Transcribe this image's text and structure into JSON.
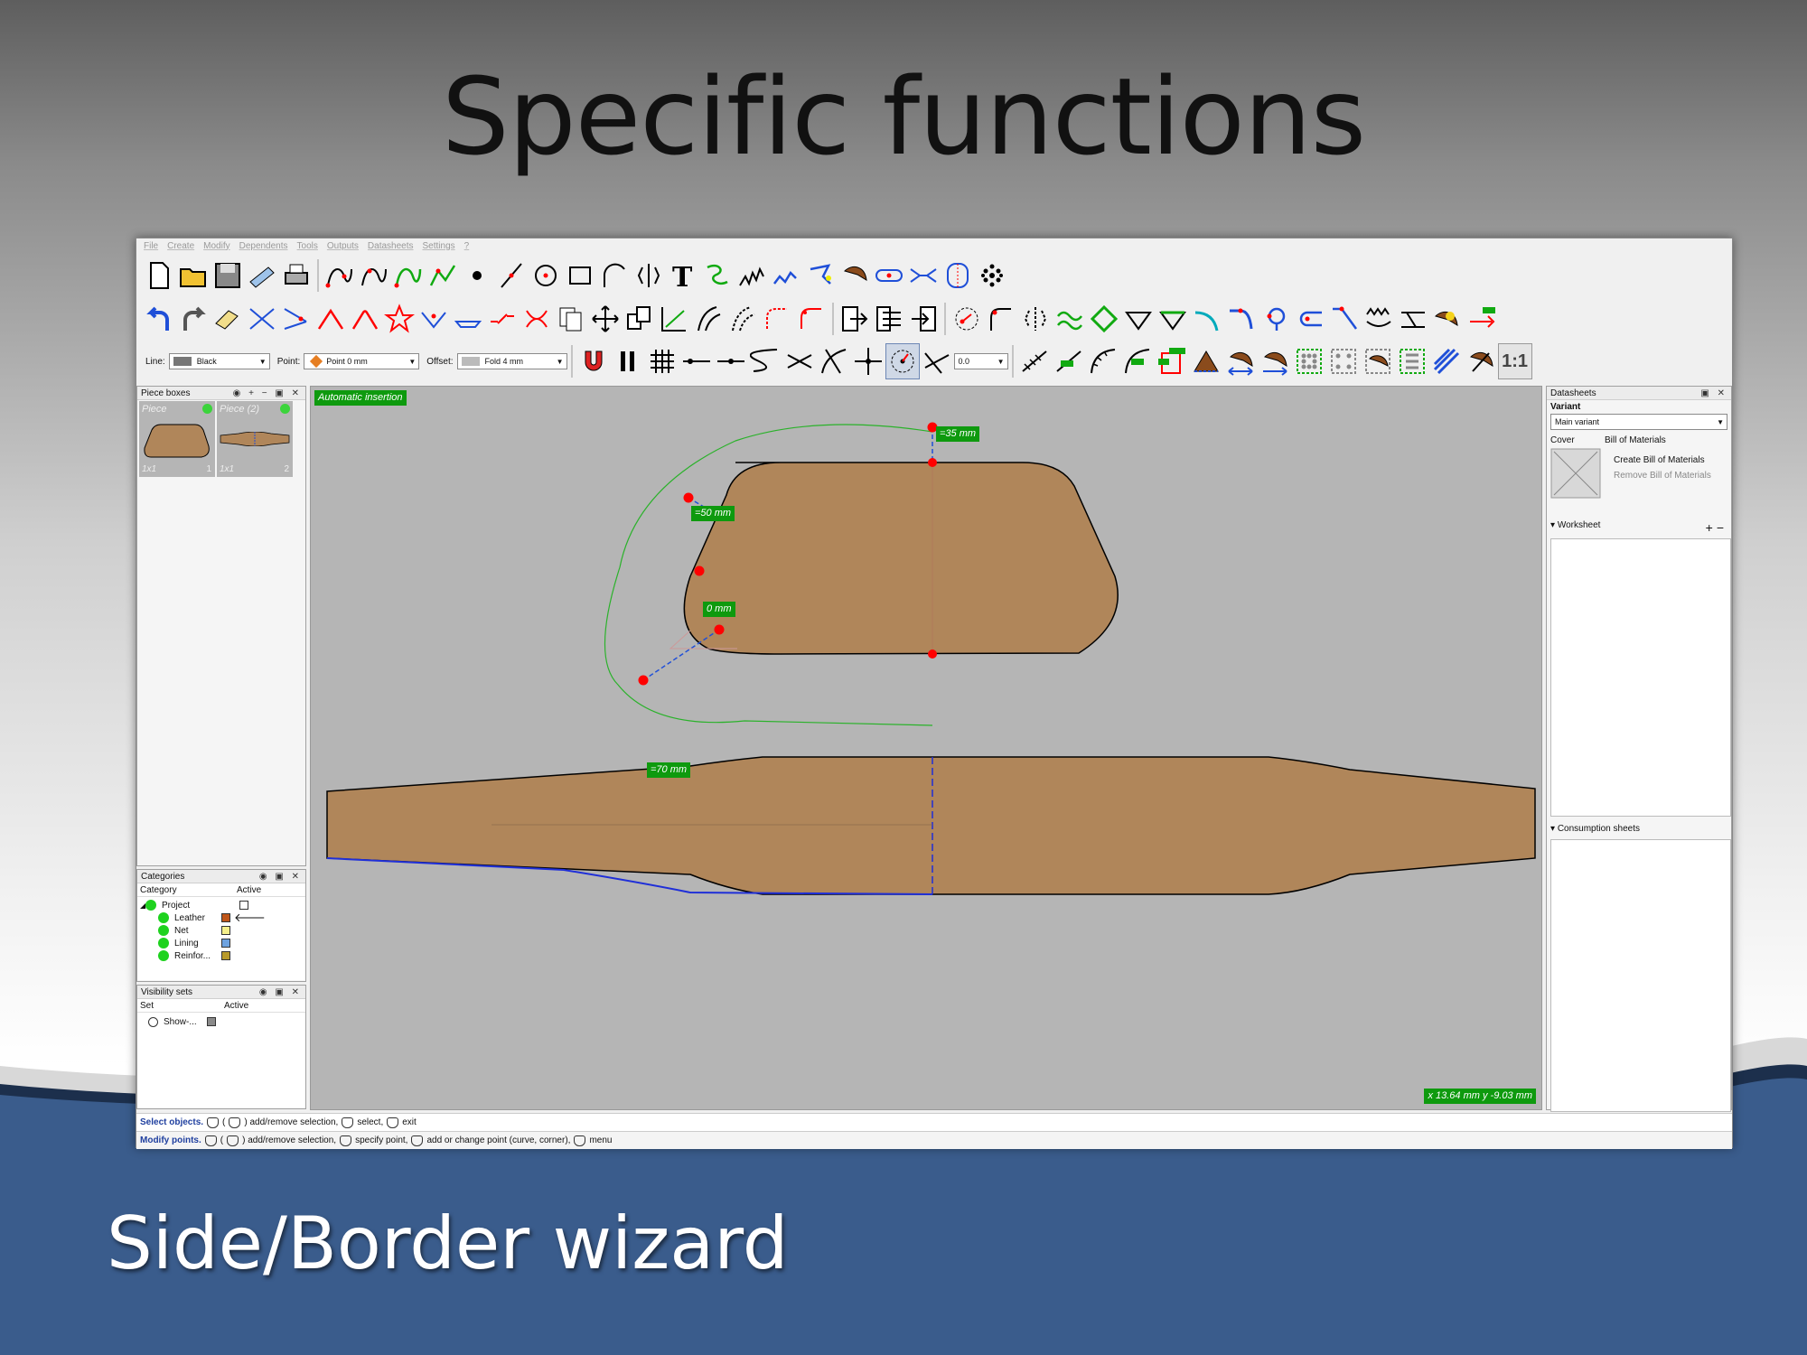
{
  "slide": {
    "title": "Specific functions",
    "subtitle": "Side/Border wizard"
  },
  "menu": [
    "File",
    "Create",
    "Modify",
    "Dependents",
    "Tools",
    "Outputs",
    "Datasheets",
    "Settings",
    "?"
  ],
  "toolbar": {
    "line_label": "Line:",
    "line_value": "Black",
    "point_label": "Point:",
    "point_value": "Point 0 mm",
    "offset_label": "Offset:",
    "offset_value": "Fold 4 mm",
    "angle_value": "0.0",
    "scale_label": "1:1"
  },
  "piece_boxes": {
    "title": "Piece boxes",
    "pieces": [
      {
        "name": "Piece",
        "qty": "1x1",
        "num": "1"
      },
      {
        "name": "Piece (2)",
        "qty": "1x1",
        "num": "2"
      }
    ]
  },
  "categories": {
    "title": "Categories",
    "col_category": "Category",
    "col_active": "Active",
    "items": [
      {
        "name": "Project",
        "color": "#ffffff"
      },
      {
        "name": "Leather",
        "color": "#c0561a"
      },
      {
        "name": "Net",
        "color": "#f5ef8a"
      },
      {
        "name": "Lining",
        "color": "#6ea3e0"
      },
      {
        "name": "Reinfor...",
        "color": "#b89a2a"
      }
    ]
  },
  "visibility_sets": {
    "title": "Visibility sets",
    "col_set": "Set",
    "col_active": "Active",
    "items": [
      {
        "name": "Show-...",
        "color": "#8a8a8a"
      }
    ]
  },
  "datasheets": {
    "title": "Datasheets",
    "variant_label": "Variant",
    "variant_value": "Main variant",
    "cover_label": "Cover",
    "bom_label": "Bill of Materials",
    "create_bom": "Create Bill of Materials",
    "remove_bom": "Remove Bill of Materials",
    "worksheet_label": "Worksheet",
    "consumption_label": "Consumption sheets"
  },
  "canvas": {
    "mode_label": "Automatic insertion",
    "dim_35": "=35 mm",
    "dim_50": "=50 mm",
    "dim_0": "0 mm",
    "dim_70": "=70 mm",
    "coords": "x 13.64 mm  y -9.03 mm",
    "piece_fill": "#b0865a"
  },
  "status": {
    "line1_bold": "Select objects.",
    "line1_rest_a": "(",
    "line1_rest_b": ") add/remove selection,",
    "line1_select": "select,",
    "line1_exit": "exit",
    "line2_bold": "Modify points.",
    "line2_a": ") add/remove selection,",
    "line2_b": "specify point,",
    "line2_c": "add or change point (curve, corner),",
    "line2_d": "menu"
  }
}
